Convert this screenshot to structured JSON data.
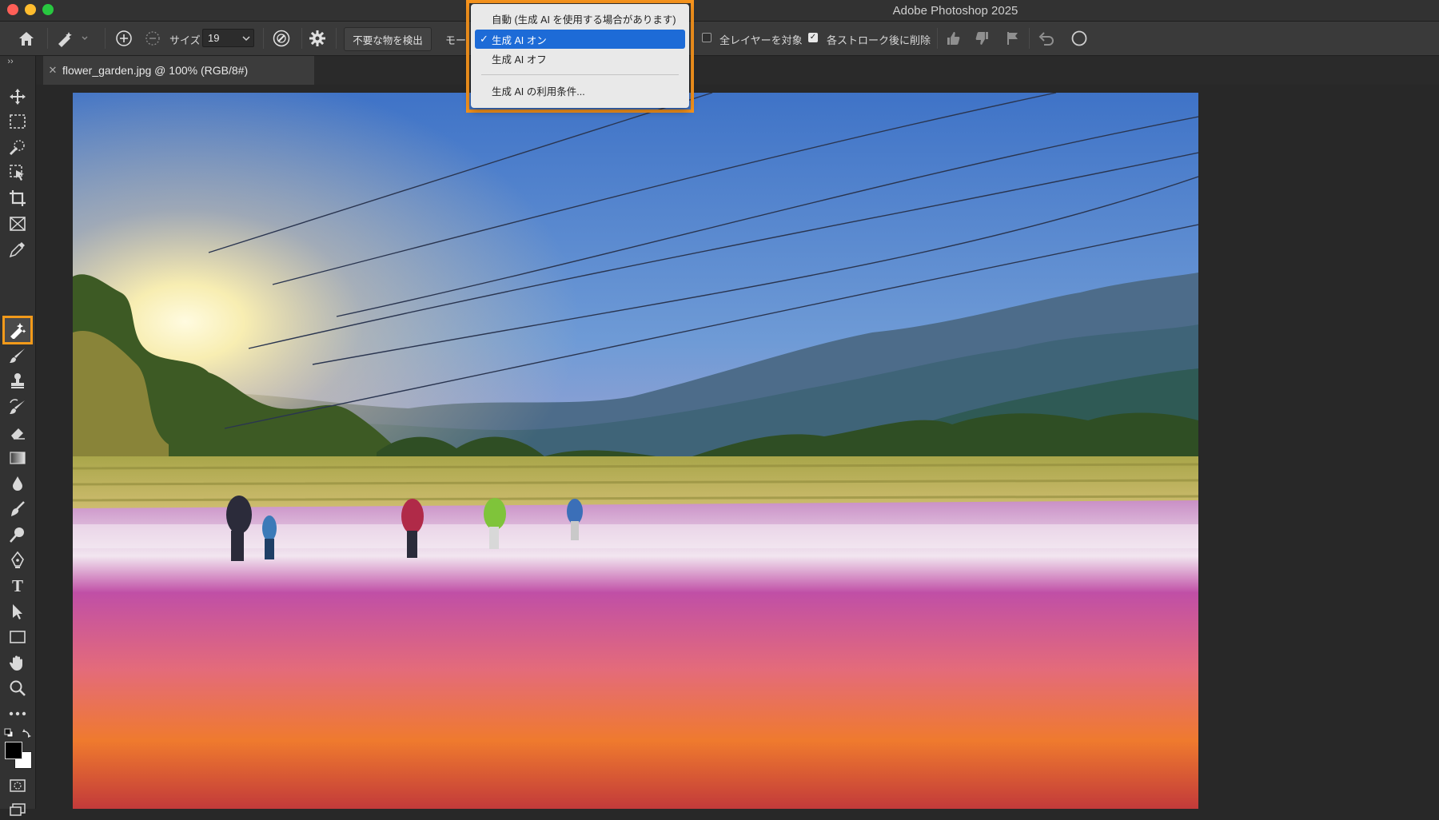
{
  "app": {
    "title": "Adobe Photoshop 2025"
  },
  "options_bar": {
    "size_label": "サイズ",
    "size_value": "19",
    "find_distractions_label": "不要な物を検出",
    "mode_label": "モード",
    "all_layers_label": "全レイヤーを対象",
    "all_layers_checked": false,
    "remove_after_stroke_label": "各ストローク後に削除",
    "remove_after_stroke_checked": true
  },
  "document": {
    "tab_title": "flower_garden.jpg @ 100% (RGB/8#)"
  },
  "mode_menu": {
    "items": [
      {
        "label": "自動 (生成 AI を使用する場合があります)",
        "selected": false
      },
      {
        "label": "生成 AI オン",
        "selected": true
      },
      {
        "label": "生成 AI オフ",
        "selected": false
      }
    ],
    "footer_item": "生成 AI の利用条件...",
    "checkmark": "✓"
  },
  "toolbar": {
    "tools": [
      "move-tool-icon",
      "marquee-tool-icon",
      "quick-selection-tool-icon",
      "object-selection-tool-icon",
      "crop-tool-icon",
      "frame-tool-icon",
      "eyedropper-tool-icon",
      "remove-tool-icon",
      "brush-tool-icon",
      "clone-stamp-tool-icon",
      "history-brush-tool-icon",
      "eraser-tool-icon",
      "gradient-tool-icon",
      "blur-tool-icon",
      "smudge-tool-icon",
      "dodge-tool-icon",
      "pen-tool-icon",
      "type-tool-icon",
      "path-selection-tool-icon",
      "rectangle-tool-icon",
      "hand-tool-icon",
      "zoom-tool-icon",
      "more-tools-icon"
    ],
    "active_tool": "remove-tool-icon",
    "accent_color": "#f29a1a"
  },
  "colors": {
    "menu_highlight": "#f7941d",
    "menu_selected": "#1d6bd7"
  }
}
